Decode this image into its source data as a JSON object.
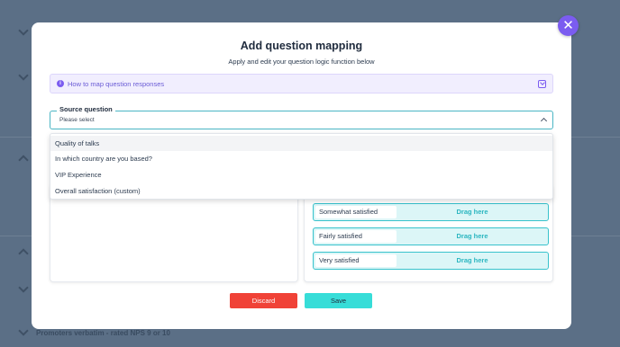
{
  "background": {
    "footer_text": "Promoters verbatim - rated NPS 9 or 10"
  },
  "modal": {
    "title": "Add question mapping",
    "subtitle": "Apply and edit your question logic function below",
    "close_icon": "close-icon",
    "howto": {
      "label": "How to map question responses",
      "icon": "info-icon",
      "expand_icon": "expand-icon"
    },
    "source_question": {
      "label": "Source question",
      "placeholder": "Please select",
      "options": [
        "Quality of talks",
        "In which country are you based?",
        "VIP Experience",
        "Overall satisfaction (custom)"
      ]
    },
    "mapping_rows": [
      {
        "response": "Somewhat satisfied",
        "target": "Drag here"
      },
      {
        "response": "Fairly satisfied",
        "target": "Drag here"
      },
      {
        "response": "Very satisfied",
        "target": "Drag here"
      }
    ],
    "buttons": {
      "discard": "Discard",
      "save": "Save"
    }
  },
  "colors": {
    "accent": "#7b5cf0",
    "teal": "#38c2cc",
    "discard": "#f04237",
    "save": "#37ddd8"
  }
}
